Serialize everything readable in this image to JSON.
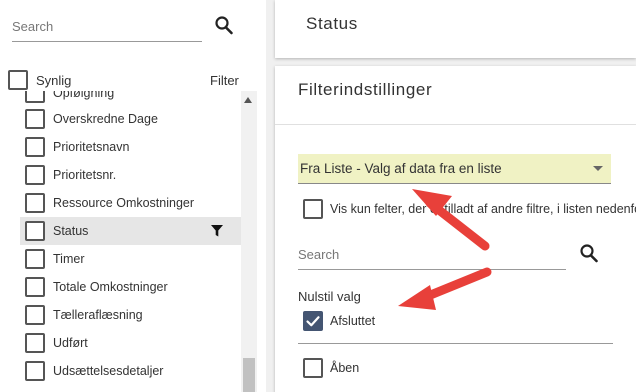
{
  "sidebar": {
    "search_placeholder": "Search",
    "header_label": "Synlig",
    "header_filter": "Filter",
    "items": [
      {
        "label": "Opfølgning"
      },
      {
        "label": "Overskredne Dage"
      },
      {
        "label": "Prioritetsnavn"
      },
      {
        "label": "Prioritetsnr."
      },
      {
        "label": "Ressource Omkostninger"
      },
      {
        "label": "Status",
        "selected": true,
        "filtered": true
      },
      {
        "label": "Timer"
      },
      {
        "label": "Totale Omkostninger"
      },
      {
        "label": "Tælleraflæsning"
      },
      {
        "label": "Udført"
      },
      {
        "label": "Udsættelsesdetaljer"
      }
    ]
  },
  "status_card": {
    "title": "Status"
  },
  "filter_panel": {
    "title": "Filterindstillinger",
    "select_value": "Fra Liste - Valg af data fra en liste",
    "visible_only_label": "Vis kun felter, der er tilladt af andre filtre, i listen nedenfor",
    "search_placeholder": "Search",
    "reset_label": "Nulstil valg",
    "options": [
      {
        "label": "Afsluttet",
        "checked": true
      },
      {
        "label": "Åben",
        "checked": false
      }
    ]
  },
  "colors": {
    "select_highlight": "#f0f2c4",
    "checkbox_checked": "#445572",
    "annotation_arrow": "#e8403a"
  },
  "icons": {
    "search": "search-icon",
    "filter": "funnel-icon",
    "caret": "chevron-down-icon",
    "check": "check-icon"
  }
}
